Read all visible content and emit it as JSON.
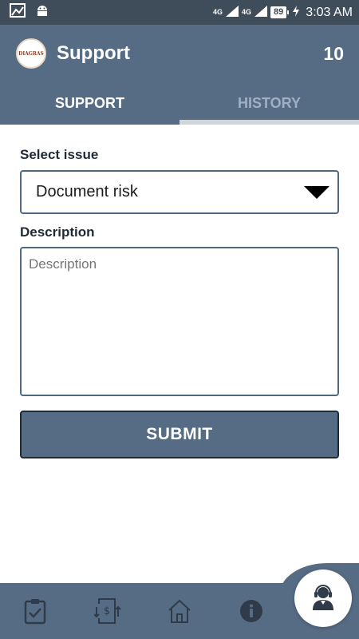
{
  "status_bar": {
    "network_label_1": "4G",
    "network_label_2": "4G",
    "battery": "89",
    "time": "3:03 AM"
  },
  "app_bar": {
    "logo_text": "DIAGRAS",
    "title": "Support",
    "count": "10"
  },
  "tabs": [
    {
      "label": "SUPPORT",
      "active": true
    },
    {
      "label": "HISTORY",
      "active": false
    }
  ],
  "form": {
    "issue_label": "Select issue",
    "issue_value": "Document risk",
    "description_label": "Description",
    "description_placeholder": "Description",
    "description_value": "",
    "submit_label": "SUBMIT"
  },
  "bottom_nav": {
    "icons": [
      "clipboard-check-icon",
      "money-transfer-icon",
      "home-icon",
      "info-icon",
      "support-agent-icon"
    ]
  },
  "colors": {
    "primary": "#566c84",
    "status_bar": "#3f4d5a",
    "inactive_tab": "#9fb0c3",
    "text_dark": "#1f2a36"
  }
}
